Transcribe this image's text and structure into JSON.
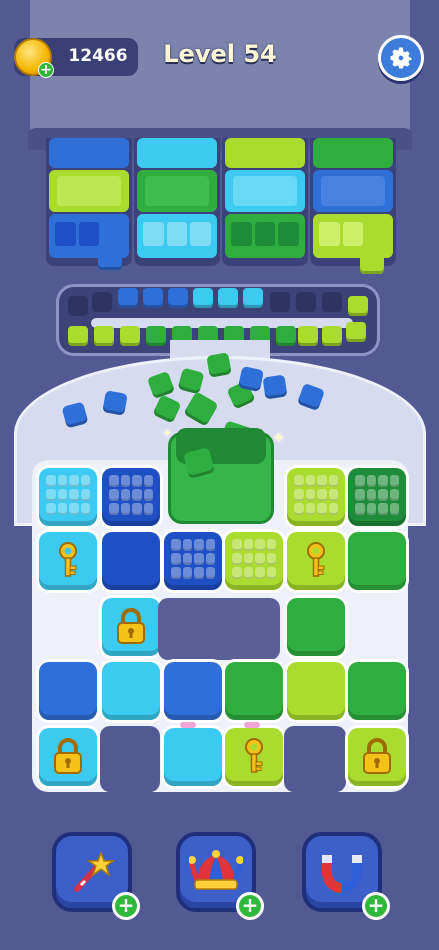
{
  "header": {
    "coins": "12466",
    "level_title": "Level 54"
  },
  "colors": {
    "blue": "#2f6fd8",
    "navy": "#1f4fc4",
    "cyan": "#3ccaf0",
    "green": "#2fae3f",
    "lime": "#a9dc2e",
    "dark_green": "#1f8c3a"
  },
  "icons": {
    "coin": "coin-icon",
    "settings": "gear-icon",
    "key": "key-icon",
    "lock": "padlock-icon",
    "wand": "magic-wand-icon",
    "jester": "jester-hat-icon",
    "magnet": "magnet-icon"
  },
  "boosters": [
    {
      "name": "magic-wand",
      "icon": "magic-wand-icon"
    },
    {
      "name": "jester-hat",
      "icon": "jester-hat-icon"
    },
    {
      "name": "magnet",
      "icon": "magnet-icon"
    }
  ]
}
